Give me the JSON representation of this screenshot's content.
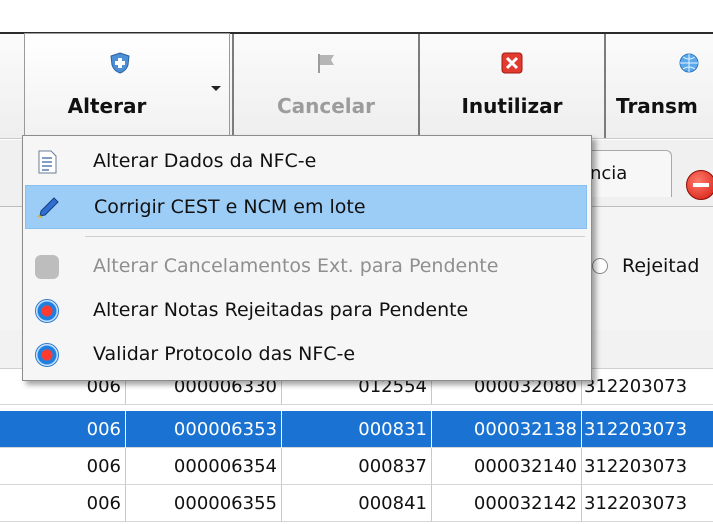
{
  "toolbar": {
    "alterar": "Alterar",
    "cancelar": "Cancelar",
    "inutilizar": "Inutilizar",
    "transmitir": "Transm"
  },
  "tabs": {
    "ocorrencia": "ncia"
  },
  "filter": {
    "rejeitadas": "Rejeitad"
  },
  "menu": {
    "items": [
      {
        "label": "Alterar Dados da NFC-e",
        "icon": "document-icon",
        "state": "normal"
      },
      {
        "label": "Corrigir CEST e NCM em lote",
        "icon": "pen-icon",
        "state": "highlighted"
      },
      {
        "label": "Alterar Cancelamentos Ext. para Pendente",
        "icon": "gray-circle-icon",
        "state": "disabled"
      },
      {
        "label": "Alterar Notas Rejeitadas para Pendente",
        "icon": "red-dot-icon",
        "state": "normal"
      },
      {
        "label": "Validar Protocolo das NFC-e",
        "icon": "red-dot-icon",
        "state": "normal"
      }
    ]
  },
  "grid": {
    "rows": [
      [
        "006",
        "000006330",
        "012554",
        "000032080",
        "312203073"
      ],
      [
        "006",
        "000006353",
        "000831",
        "000032138",
        "312203073"
      ],
      [
        "006",
        "000006354",
        "000837",
        "000032140",
        "312203073"
      ],
      [
        "006",
        "000006355",
        "000841",
        "000032142",
        "312203073"
      ]
    ],
    "selected_row": 1
  },
  "colors": {
    "selection": "#1a73d2",
    "menu_highlight": "#9ccdf7"
  }
}
